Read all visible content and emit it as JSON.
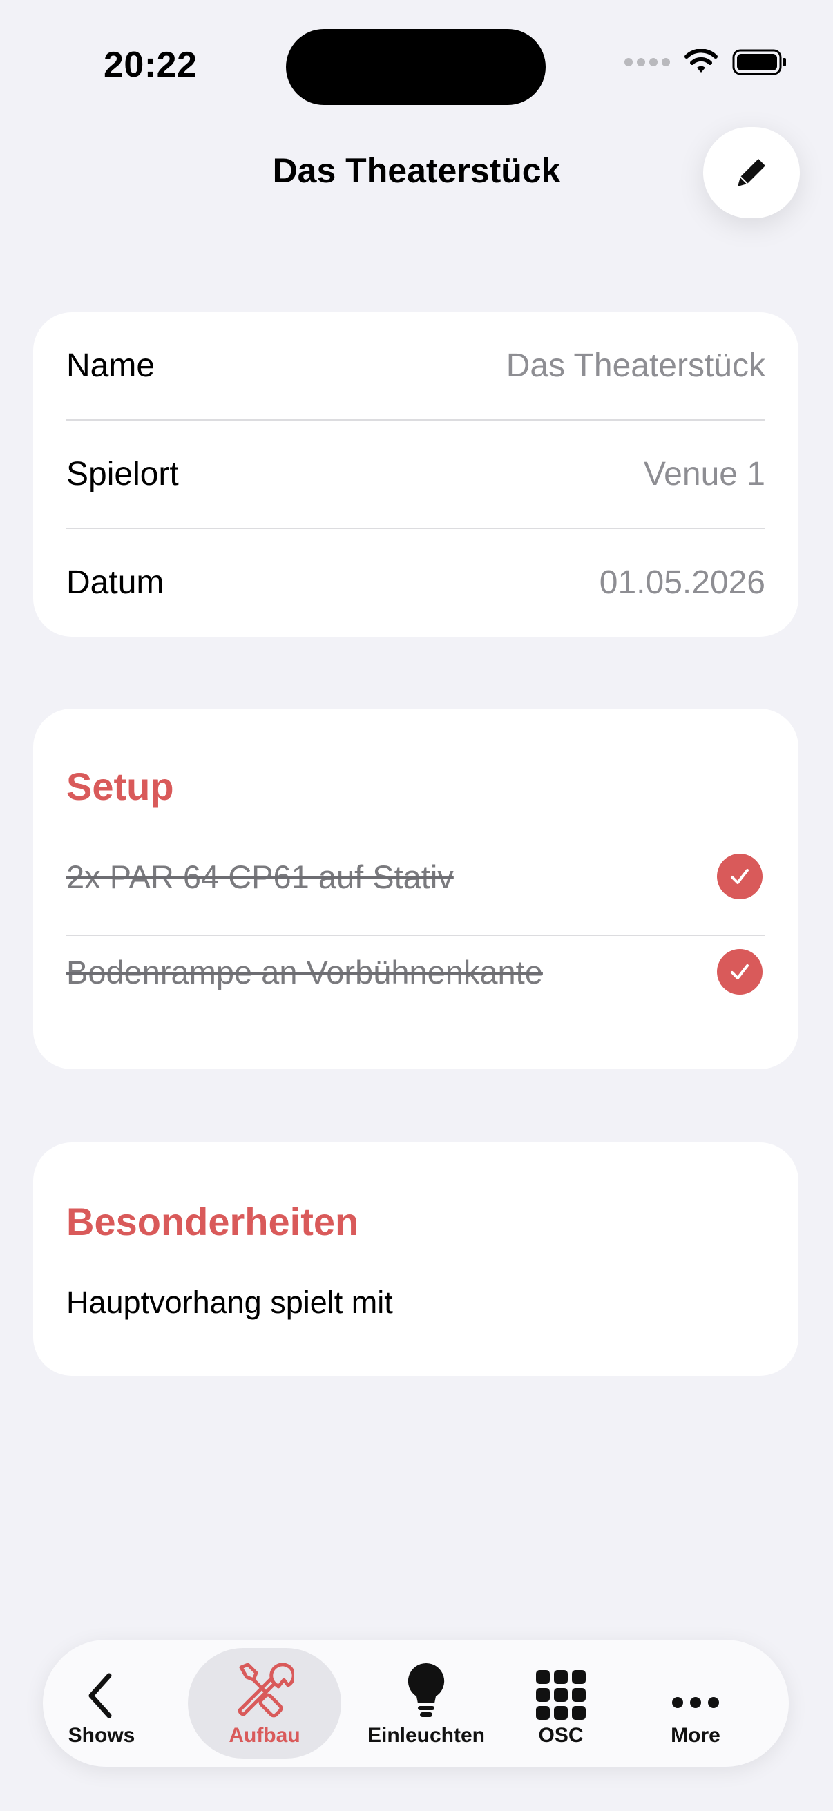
{
  "status_bar": {
    "time": "20:22"
  },
  "nav": {
    "title": "Das Theaterstück",
    "edit_icon": "pencil-icon"
  },
  "info": {
    "rows": [
      {
        "label": "Name",
        "value": "Das Theaterstück"
      },
      {
        "label": "Spielort",
        "value": "Venue 1"
      },
      {
        "label": "Datum",
        "value": "01.05.2026"
      }
    ]
  },
  "setup": {
    "title": "Setup",
    "items": [
      {
        "text": "2x PAR 64 CP61 auf Stativ",
        "checked": true
      },
      {
        "text": "Bodenrampe an Vorbühnenkante",
        "checked": true
      }
    ]
  },
  "notes": {
    "title": "Besonderheiten",
    "text": "Hauptvorhang spielt mit"
  },
  "tabbar": {
    "tabs": [
      {
        "label": "Shows",
        "icon": "chevron-left-icon"
      },
      {
        "label": "Aufbau",
        "icon": "tools-icon",
        "active": true
      },
      {
        "label": "Einleuchten",
        "icon": "lightbulb-icon"
      },
      {
        "label": "OSC",
        "icon": "grid-icon"
      },
      {
        "label": "More",
        "icon": "ellipsis-icon"
      }
    ]
  },
  "colors": {
    "accent": "#d95a5a",
    "background": "#f2f2f7",
    "secondary_text": "#8e8e93"
  }
}
